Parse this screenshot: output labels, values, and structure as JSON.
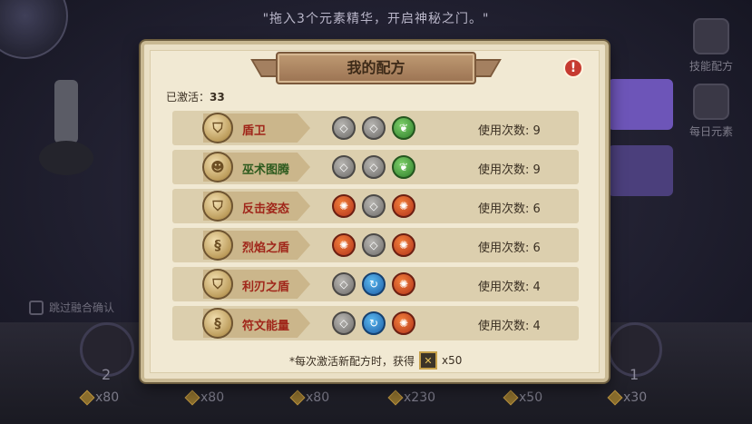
{
  "hint_text": "\"拖入3个元素精华，开启神秘之门。\"",
  "side_buttons": {
    "skills_label": "技能配方",
    "daily_label": "每日元素"
  },
  "skip_confirm_label": "跳过融合确认",
  "bottom_slots": [
    {
      "count": "2"
    },
    {
      "count": "1"
    }
  ],
  "bottom_costs": [
    "x80",
    "x80",
    "x80",
    "x230",
    "x50",
    "x30"
  ],
  "modal": {
    "title": "我的配方",
    "info_icon_label": "!",
    "activated_label": "已激活：",
    "activated_count": "33",
    "recipes": [
      {
        "name": "盾卫",
        "name_color": "#a0261a",
        "emblem": "shield-emblem",
        "elements": [
          "neutral",
          "neutral",
          "nature"
        ],
        "uses": "使用次数: 9"
      },
      {
        "name": "巫术图腾",
        "name_color": "#2c5a1d",
        "emblem": "totem-emblem",
        "elements": [
          "neutral",
          "neutral",
          "nature"
        ],
        "uses": "使用次数: 9"
      },
      {
        "name": "反击姿态",
        "name_color": "#a0261a",
        "emblem": "shield-emblem",
        "elements": [
          "fire",
          "neutral",
          "fire"
        ],
        "uses": "使用次数: 6"
      },
      {
        "name": "烈焰之盾",
        "name_color": "#a0261a",
        "emblem": "swirl-emblem",
        "elements": [
          "fire",
          "neutral",
          "fire"
        ],
        "uses": "使用次数: 6"
      },
      {
        "name": "利刃之盾",
        "name_color": "#a0261a",
        "emblem": "shield-emblem",
        "elements": [
          "neutral",
          "water",
          "fire"
        ],
        "uses": "使用次数: 4"
      },
      {
        "name": "符文能量",
        "name_color": "#a0261a",
        "emblem": "swirl-emblem",
        "elements": [
          "neutral",
          "water",
          "fire"
        ],
        "uses": "使用次数: 4"
      }
    ],
    "footer_note": "*每次激活新配方时，获得",
    "footer_reward": "x50"
  }
}
